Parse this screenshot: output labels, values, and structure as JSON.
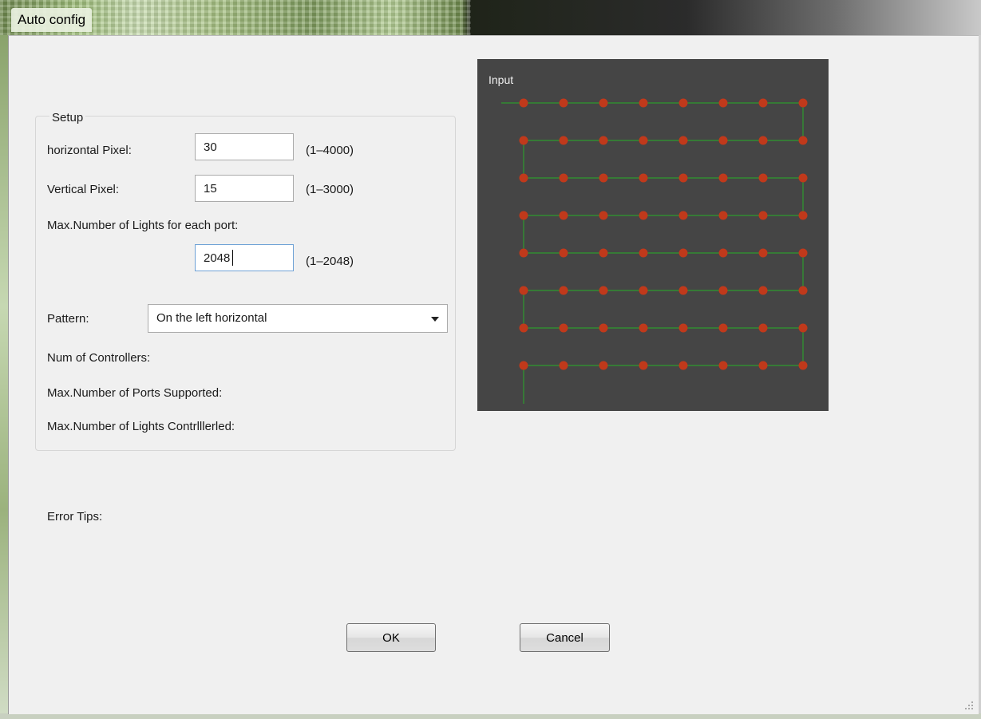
{
  "window": {
    "title": "Auto config"
  },
  "setup": {
    "legend": "Setup",
    "horizontal": {
      "label": "horizontal Pixel:",
      "value": "30",
      "range": "(1–4000)"
    },
    "vertical": {
      "label": "Vertical Pixel:",
      "value": "15",
      "range": "(1–3000)"
    },
    "max_lights": {
      "label": "Max.Number of Lights for each port:",
      "value": "2048",
      "range": "(1–2048)"
    },
    "pattern": {
      "label": "Pattern:",
      "selected": "On the left horizontal"
    },
    "num_controllers": "Num of Controllers:",
    "max_ports": "Max.Number of Ports Supported:",
    "max_lights_controlled": "Max.Number of Lights Contrlllerled:"
  },
  "error_tips": "Error Tips:",
  "preview": {
    "label": "Input",
    "grid": {
      "columns": 8,
      "rows": 8
    },
    "colors": {
      "background": "#454545",
      "dot": "#c0391b",
      "line": "#2e9a2e"
    }
  },
  "buttons": {
    "ok": "OK",
    "cancel": "Cancel"
  }
}
